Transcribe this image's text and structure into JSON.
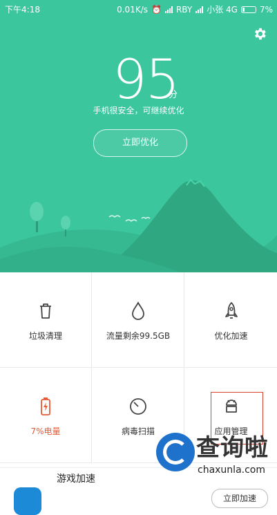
{
  "status_bar": {
    "time": "下午4:18",
    "speed": "0.01K/s",
    "carrier1": "RBY",
    "carrier2": "小张 4G",
    "battery": "7%"
  },
  "hero": {
    "score": "95",
    "score_unit": "分",
    "subtitle": "手机很安全，可继续优化",
    "optimize_label": "立即优化",
    "bg_color": "#3cc69e"
  },
  "grid": {
    "items": [
      {
        "label": "垃圾清理",
        "icon": "trash-icon"
      },
      {
        "label": "流量剩余99.5GB",
        "icon": "drop-icon"
      },
      {
        "label": "优化加速",
        "icon": "rocket-icon"
      },
      {
        "label": "7%电量",
        "icon": "battery-icon",
        "color": "#e85a33"
      },
      {
        "label": "病毒扫描",
        "icon": "scan-icon"
      },
      {
        "label": "应用管理",
        "icon": "android-icon"
      }
    ]
  },
  "bottom": {
    "title": "游戏加速",
    "button_label": "立即加速"
  },
  "watermark": {
    "cn": "查询啦",
    "en": "chaxunla.com"
  }
}
